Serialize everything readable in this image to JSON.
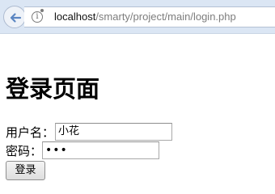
{
  "browser": {
    "url_host": "localhost",
    "url_path": "/smarty/project/main/login.php",
    "icons": {
      "back": "back-arrow-icon",
      "site_info": "info-icon"
    }
  },
  "page": {
    "title": "登录页面"
  },
  "form": {
    "username_label": "用户名：",
    "username_value": "小花",
    "password_label": "密码：",
    "password_value": "•••",
    "submit_label": "登录"
  },
  "colors": {
    "toolbar_bg": "#dbe6f4",
    "back_arrow": "#5b86c2"
  }
}
